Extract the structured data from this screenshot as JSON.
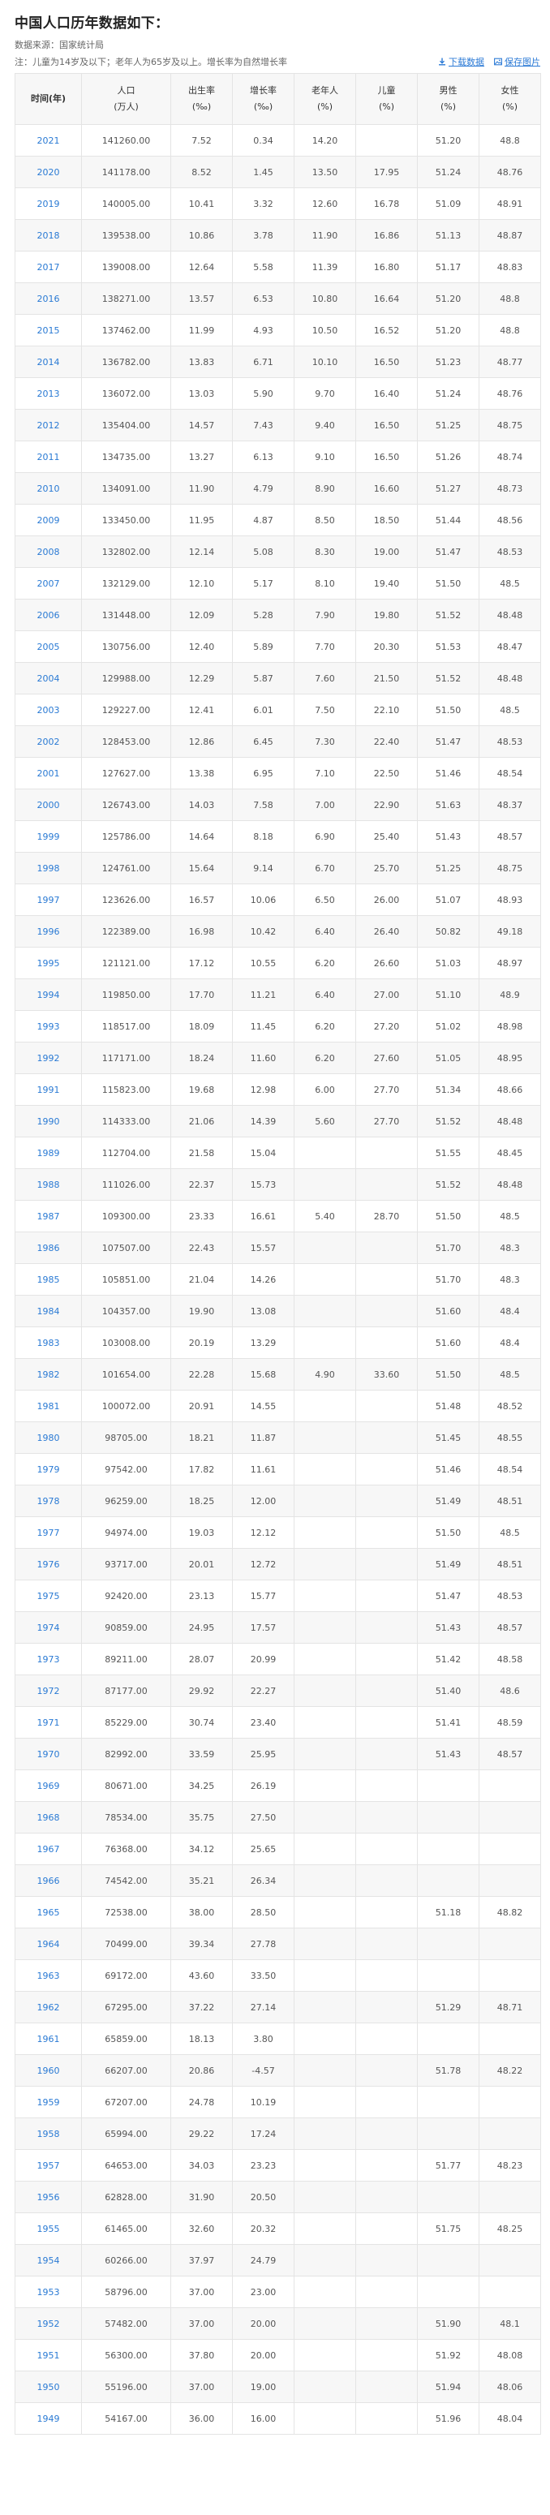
{
  "page": {
    "title": "中国人口历年数据如下：",
    "source": "数据来源：国家统计局",
    "note": "注：儿童为14岁及以下；老年人为65岁及以上。增长率为自然增长率",
    "download_label": "下载数据",
    "save_label": "保存图片"
  },
  "table": {
    "headers": [
      [
        "时间(年)"
      ],
      [
        "人口",
        "(万人)"
      ],
      [
        "出生率",
        "(‰)"
      ],
      [
        "增长率",
        "(‰)"
      ],
      [
        "老年人",
        "(%)"
      ],
      [
        "儿童",
        "(%)"
      ],
      [
        "男性",
        "(%)"
      ],
      [
        "女性",
        "(%)"
      ]
    ],
    "rows": [
      [
        "2021",
        "141260.00",
        "7.52",
        "0.34",
        "14.20",
        "",
        "51.20",
        "48.8"
      ],
      [
        "2020",
        "141178.00",
        "8.52",
        "1.45",
        "13.50",
        "17.95",
        "51.24",
        "48.76"
      ],
      [
        "2019",
        "140005.00",
        "10.41",
        "3.32",
        "12.60",
        "16.78",
        "51.09",
        "48.91"
      ],
      [
        "2018",
        "139538.00",
        "10.86",
        "3.78",
        "11.90",
        "16.86",
        "51.13",
        "48.87"
      ],
      [
        "2017",
        "139008.00",
        "12.64",
        "5.58",
        "11.39",
        "16.80",
        "51.17",
        "48.83"
      ],
      [
        "2016",
        "138271.00",
        "13.57",
        "6.53",
        "10.80",
        "16.64",
        "51.20",
        "48.8"
      ],
      [
        "2015",
        "137462.00",
        "11.99",
        "4.93",
        "10.50",
        "16.52",
        "51.20",
        "48.8"
      ],
      [
        "2014",
        "136782.00",
        "13.83",
        "6.71",
        "10.10",
        "16.50",
        "51.23",
        "48.77"
      ],
      [
        "2013",
        "136072.00",
        "13.03",
        "5.90",
        "9.70",
        "16.40",
        "51.24",
        "48.76"
      ],
      [
        "2012",
        "135404.00",
        "14.57",
        "7.43",
        "9.40",
        "16.50",
        "51.25",
        "48.75"
      ],
      [
        "2011",
        "134735.00",
        "13.27",
        "6.13",
        "9.10",
        "16.50",
        "51.26",
        "48.74"
      ],
      [
        "2010",
        "134091.00",
        "11.90",
        "4.79",
        "8.90",
        "16.60",
        "51.27",
        "48.73"
      ],
      [
        "2009",
        "133450.00",
        "11.95",
        "4.87",
        "8.50",
        "18.50",
        "51.44",
        "48.56"
      ],
      [
        "2008",
        "132802.00",
        "12.14",
        "5.08",
        "8.30",
        "19.00",
        "51.47",
        "48.53"
      ],
      [
        "2007",
        "132129.00",
        "12.10",
        "5.17",
        "8.10",
        "19.40",
        "51.50",
        "48.5"
      ],
      [
        "2006",
        "131448.00",
        "12.09",
        "5.28",
        "7.90",
        "19.80",
        "51.52",
        "48.48"
      ],
      [
        "2005",
        "130756.00",
        "12.40",
        "5.89",
        "7.70",
        "20.30",
        "51.53",
        "48.47"
      ],
      [
        "2004",
        "129988.00",
        "12.29",
        "5.87",
        "7.60",
        "21.50",
        "51.52",
        "48.48"
      ],
      [
        "2003",
        "129227.00",
        "12.41",
        "6.01",
        "7.50",
        "22.10",
        "51.50",
        "48.5"
      ],
      [
        "2002",
        "128453.00",
        "12.86",
        "6.45",
        "7.30",
        "22.40",
        "51.47",
        "48.53"
      ],
      [
        "2001",
        "127627.00",
        "13.38",
        "6.95",
        "7.10",
        "22.50",
        "51.46",
        "48.54"
      ],
      [
        "2000",
        "126743.00",
        "14.03",
        "7.58",
        "7.00",
        "22.90",
        "51.63",
        "48.37"
      ],
      [
        "1999",
        "125786.00",
        "14.64",
        "8.18",
        "6.90",
        "25.40",
        "51.43",
        "48.57"
      ],
      [
        "1998",
        "124761.00",
        "15.64",
        "9.14",
        "6.70",
        "25.70",
        "51.25",
        "48.75"
      ],
      [
        "1997",
        "123626.00",
        "16.57",
        "10.06",
        "6.50",
        "26.00",
        "51.07",
        "48.93"
      ],
      [
        "1996",
        "122389.00",
        "16.98",
        "10.42",
        "6.40",
        "26.40",
        "50.82",
        "49.18"
      ],
      [
        "1995",
        "121121.00",
        "17.12",
        "10.55",
        "6.20",
        "26.60",
        "51.03",
        "48.97"
      ],
      [
        "1994",
        "119850.00",
        "17.70",
        "11.21",
        "6.40",
        "27.00",
        "51.10",
        "48.9"
      ],
      [
        "1993",
        "118517.00",
        "18.09",
        "11.45",
        "6.20",
        "27.20",
        "51.02",
        "48.98"
      ],
      [
        "1992",
        "117171.00",
        "18.24",
        "11.60",
        "6.20",
        "27.60",
        "51.05",
        "48.95"
      ],
      [
        "1991",
        "115823.00",
        "19.68",
        "12.98",
        "6.00",
        "27.70",
        "51.34",
        "48.66"
      ],
      [
        "1990",
        "114333.00",
        "21.06",
        "14.39",
        "5.60",
        "27.70",
        "51.52",
        "48.48"
      ],
      [
        "1989",
        "112704.00",
        "21.58",
        "15.04",
        "",
        "",
        "51.55",
        "48.45"
      ],
      [
        "1988",
        "111026.00",
        "22.37",
        "15.73",
        "",
        "",
        "51.52",
        "48.48"
      ],
      [
        "1987",
        "109300.00",
        "23.33",
        "16.61",
        "5.40",
        "28.70",
        "51.50",
        "48.5"
      ],
      [
        "1986",
        "107507.00",
        "22.43",
        "15.57",
        "",
        "",
        "51.70",
        "48.3"
      ],
      [
        "1985",
        "105851.00",
        "21.04",
        "14.26",
        "",
        "",
        "51.70",
        "48.3"
      ],
      [
        "1984",
        "104357.00",
        "19.90",
        "13.08",
        "",
        "",
        "51.60",
        "48.4"
      ],
      [
        "1983",
        "103008.00",
        "20.19",
        "13.29",
        "",
        "",
        "51.60",
        "48.4"
      ],
      [
        "1982",
        "101654.00",
        "22.28",
        "15.68",
        "4.90",
        "33.60",
        "51.50",
        "48.5"
      ],
      [
        "1981",
        "100072.00",
        "20.91",
        "14.55",
        "",
        "",
        "51.48",
        "48.52"
      ],
      [
        "1980",
        "98705.00",
        "18.21",
        "11.87",
        "",
        "",
        "51.45",
        "48.55"
      ],
      [
        "1979",
        "97542.00",
        "17.82",
        "11.61",
        "",
        "",
        "51.46",
        "48.54"
      ],
      [
        "1978",
        "96259.00",
        "18.25",
        "12.00",
        "",
        "",
        "51.49",
        "48.51"
      ],
      [
        "1977",
        "94974.00",
        "19.03",
        "12.12",
        "",
        "",
        "51.50",
        "48.5"
      ],
      [
        "1976",
        "93717.00",
        "20.01",
        "12.72",
        "",
        "",
        "51.49",
        "48.51"
      ],
      [
        "1975",
        "92420.00",
        "23.13",
        "15.77",
        "",
        "",
        "51.47",
        "48.53"
      ],
      [
        "1974",
        "90859.00",
        "24.95",
        "17.57",
        "",
        "",
        "51.43",
        "48.57"
      ],
      [
        "1973",
        "89211.00",
        "28.07",
        "20.99",
        "",
        "",
        "51.42",
        "48.58"
      ],
      [
        "1972",
        "87177.00",
        "29.92",
        "22.27",
        "",
        "",
        "51.40",
        "48.6"
      ],
      [
        "1971",
        "85229.00",
        "30.74",
        "23.40",
        "",
        "",
        "51.41",
        "48.59"
      ],
      [
        "1970",
        "82992.00",
        "33.59",
        "25.95",
        "",
        "",
        "51.43",
        "48.57"
      ],
      [
        "1969",
        "80671.00",
        "34.25",
        "26.19",
        "",
        "",
        "",
        ""
      ],
      [
        "1968",
        "78534.00",
        "35.75",
        "27.50",
        "",
        "",
        "",
        ""
      ],
      [
        "1967",
        "76368.00",
        "34.12",
        "25.65",
        "",
        "",
        "",
        ""
      ],
      [
        "1966",
        "74542.00",
        "35.21",
        "26.34",
        "",
        "",
        "",
        ""
      ],
      [
        "1965",
        "72538.00",
        "38.00",
        "28.50",
        "",
        "",
        "51.18",
        "48.82"
      ],
      [
        "1964",
        "70499.00",
        "39.34",
        "27.78",
        "",
        "",
        "",
        ""
      ],
      [
        "1963",
        "69172.00",
        "43.60",
        "33.50",
        "",
        "",
        "",
        ""
      ],
      [
        "1962",
        "67295.00",
        "37.22",
        "27.14",
        "",
        "",
        "51.29",
        "48.71"
      ],
      [
        "1961",
        "65859.00",
        "18.13",
        "3.80",
        "",
        "",
        "",
        ""
      ],
      [
        "1960",
        "66207.00",
        "20.86",
        "-4.57",
        "",
        "",
        "51.78",
        "48.22"
      ],
      [
        "1959",
        "67207.00",
        "24.78",
        "10.19",
        "",
        "",
        "",
        ""
      ],
      [
        "1958",
        "65994.00",
        "29.22",
        "17.24",
        "",
        "",
        "",
        ""
      ],
      [
        "1957",
        "64653.00",
        "34.03",
        "23.23",
        "",
        "",
        "51.77",
        "48.23"
      ],
      [
        "1956",
        "62828.00",
        "31.90",
        "20.50",
        "",
        "",
        "",
        ""
      ],
      [
        "1955",
        "61465.00",
        "32.60",
        "20.32",
        "",
        "",
        "51.75",
        "48.25"
      ],
      [
        "1954",
        "60266.00",
        "37.97",
        "24.79",
        "",
        "",
        "",
        ""
      ],
      [
        "1953",
        "58796.00",
        "37.00",
        "23.00",
        "",
        "",
        "",
        ""
      ],
      [
        "1952",
        "57482.00",
        "37.00",
        "20.00",
        "",
        "",
        "51.90",
        "48.1"
      ],
      [
        "1951",
        "56300.00",
        "37.80",
        "20.00",
        "",
        "",
        "51.92",
        "48.08"
      ],
      [
        "1950",
        "55196.00",
        "37.00",
        "19.00",
        "",
        "",
        "51.94",
        "48.06"
      ],
      [
        "1949",
        "54167.00",
        "36.00",
        "16.00",
        "",
        "",
        "51.96",
        "48.04"
      ]
    ]
  }
}
